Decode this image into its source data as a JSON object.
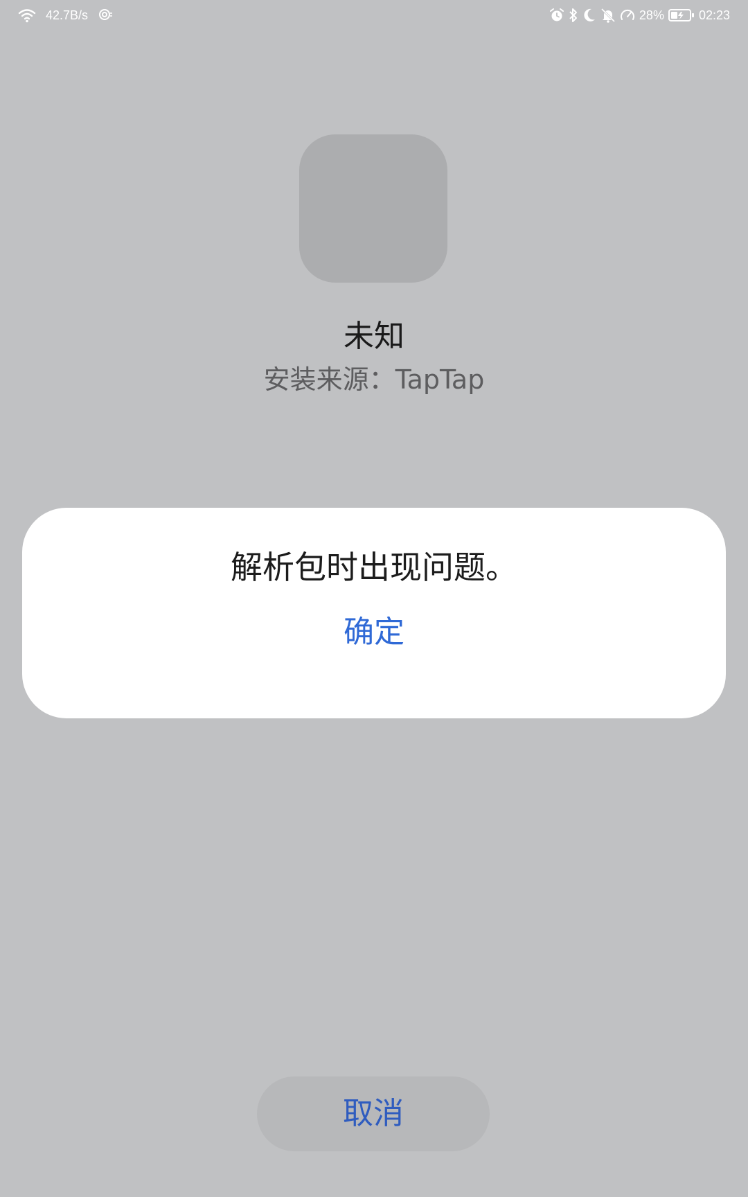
{
  "status_bar": {
    "net_speed": "42.7B/s",
    "battery_percent": "28%",
    "time": "02:23",
    "icons_left": [
      "wifi-icon",
      "hotspot-icon"
    ],
    "icons_right": [
      "alarm-icon",
      "bluetooth-icon",
      "moon-icon",
      "bell-off-icon",
      "speedometer-icon",
      "battery-charging-icon"
    ]
  },
  "app": {
    "name": "未知",
    "install_source": "安装来源：TapTap"
  },
  "dialog": {
    "message": "解析包时出现问题。",
    "confirm_label": "确定"
  },
  "cancel_label": "取消",
  "colors": {
    "background": "#c0c1c3",
    "icon_placeholder": "#acadaf",
    "dialog_bg": "#ffffff",
    "accent_blue": "#2f69d6",
    "cancel_bg": "#b7b8ba"
  }
}
